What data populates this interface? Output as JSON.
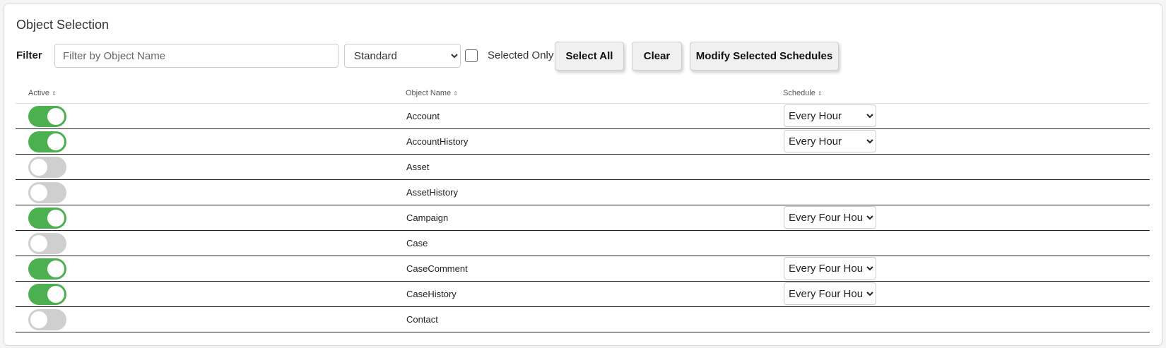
{
  "section": {
    "title": "Object Selection"
  },
  "filter": {
    "label": "Filter",
    "placeholder": "Filter by Object Name",
    "value": "",
    "type_selected": "Standard",
    "selected_only_label": "Selected Only",
    "selected_only_checked": false
  },
  "buttons": {
    "select_all": "Select All",
    "clear": "Clear",
    "modify": "Modify Selected Schedules"
  },
  "table": {
    "columns": [
      "Active",
      "Object Name",
      "Schedule"
    ],
    "rows": [
      {
        "active": true,
        "name": "Account",
        "schedule": "Every Hour"
      },
      {
        "active": true,
        "name": "AccountHistory",
        "schedule": "Every Hour"
      },
      {
        "active": false,
        "name": "Asset",
        "schedule": ""
      },
      {
        "active": false,
        "name": "AssetHistory",
        "schedule": ""
      },
      {
        "active": true,
        "name": "Campaign",
        "schedule": "Every Four Hours"
      },
      {
        "active": false,
        "name": "Case",
        "schedule": ""
      },
      {
        "active": true,
        "name": "CaseComment",
        "schedule": "Every Four Hours"
      },
      {
        "active": true,
        "name": "CaseHistory",
        "schedule": "Every Four Hours"
      },
      {
        "active": false,
        "name": "Contact",
        "schedule": ""
      }
    ]
  },
  "icons": {
    "sort": "sort-icon",
    "dropdown": "chevron-down-icon"
  },
  "colors": {
    "toggle_on": "#4caf50",
    "toggle_off": "#cfcfcf",
    "row_divider": "#222222"
  }
}
